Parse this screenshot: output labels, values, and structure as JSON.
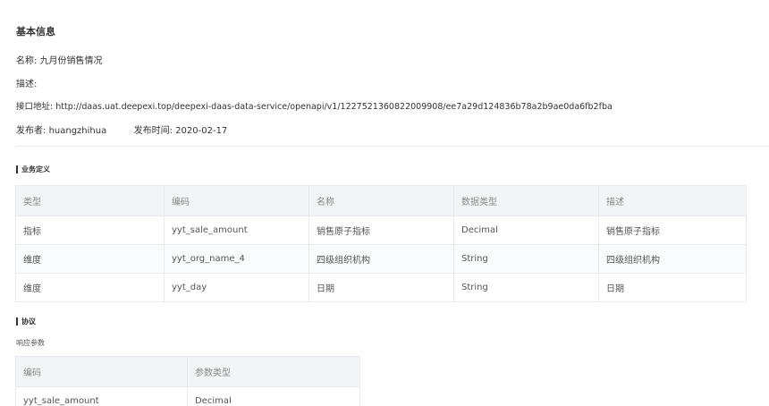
{
  "basic_info": {
    "title": "基本信息",
    "name_label": "名称:",
    "name_value": "九月份销售情况",
    "desc_label": "描述:",
    "desc_value": "",
    "api_label": "接口地址:",
    "api_value": "http://daas.uat.deepexi.top/deepexi-daas-data-service/openapi/v1/1227521360822009908/ee7a29d124836b78a2b9ae0da6fb2fba",
    "publisher_label": "发布者:",
    "publisher_value": "huangzhihua",
    "publish_time_label": "发布时间:",
    "publish_time_value": "2020-02-17"
  },
  "business": {
    "title": "业务定义",
    "columns": [
      "类型",
      "编码",
      "名称",
      "数据类型",
      "描述"
    ],
    "rows": [
      [
        "指标",
        "yyt_sale_amount",
        "销售原子指标",
        "Decimal",
        "销售原子指标"
      ],
      [
        "维度",
        "yyt_org_name_4",
        "四级组织机构",
        "String",
        "四级组织机构"
      ],
      [
        "维度",
        "yyt_day",
        "日期",
        "String",
        "日期"
      ]
    ]
  },
  "protocol": {
    "title": "协议",
    "response_label": "响应参数",
    "columns": [
      "编码",
      "参数类型"
    ],
    "rows": [
      [
        "yyt_sale_amount",
        "Decimal"
      ]
    ]
  }
}
